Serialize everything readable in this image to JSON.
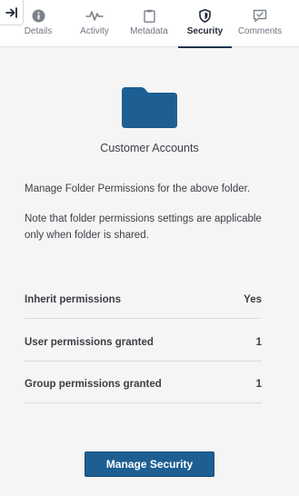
{
  "tabs": [
    {
      "id": "details",
      "label": "Details",
      "icon": "info-icon"
    },
    {
      "id": "activity",
      "label": "Activity",
      "icon": "activity-pulse-icon"
    },
    {
      "id": "metadata",
      "label": "Metadata",
      "icon": "clipboard-icon"
    },
    {
      "id": "security",
      "label": "Security",
      "icon": "shield-icon",
      "active": true
    },
    {
      "id": "comments",
      "label": "Comments",
      "icon": "comment-check-icon"
    }
  ],
  "folder": {
    "name": "Customer Accounts",
    "icon": "folder-icon",
    "color": "#1d5f93"
  },
  "description": {
    "line1": "Manage Folder Permissions for the above folder.",
    "line2": "Note that folder permissions settings are applicable only when folder is shared."
  },
  "permissions": [
    {
      "label": "Inherit permissions",
      "value": "Yes"
    },
    {
      "label": "User permissions granted",
      "value": "1"
    },
    {
      "label": "Group permissions granted",
      "value": "1"
    }
  ],
  "actions": {
    "manage_security": "Manage Security"
  },
  "colors": {
    "accent": "#1d5f93",
    "active_tab_underline": "#1f3350"
  }
}
